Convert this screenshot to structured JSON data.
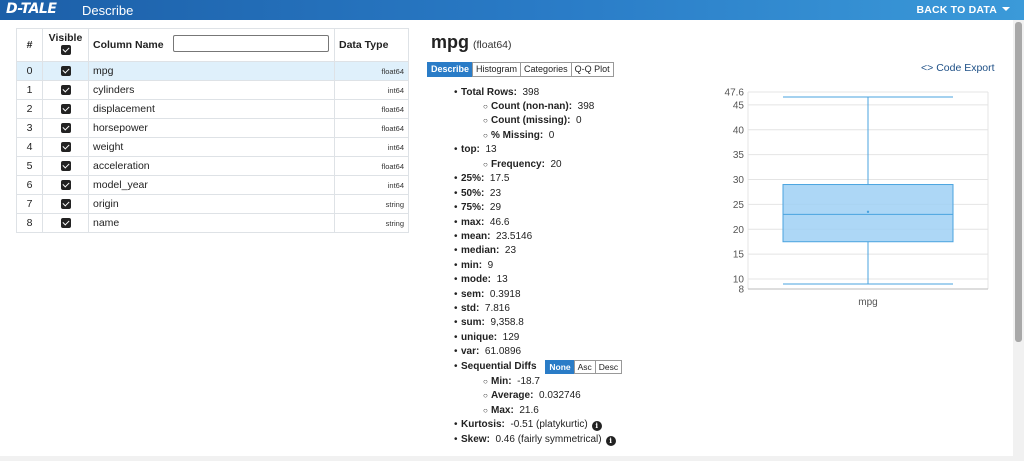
{
  "header": {
    "logo": "D-TALE",
    "title": "Describe",
    "back_label": "BACK TO DATA"
  },
  "table": {
    "headers": {
      "index": "#",
      "visible": "Visible",
      "name": "Column Name",
      "dtype": "Data Type"
    },
    "rows": [
      {
        "index": "0",
        "name": "mpg",
        "dtype": "float64"
      },
      {
        "index": "1",
        "name": "cylinders",
        "dtype": "int64"
      },
      {
        "index": "2",
        "name": "displacement",
        "dtype": "float64"
      },
      {
        "index": "3",
        "name": "horsepower",
        "dtype": "float64"
      },
      {
        "index": "4",
        "name": "weight",
        "dtype": "int64"
      },
      {
        "index": "5",
        "name": "acceleration",
        "dtype": "float64"
      },
      {
        "index": "6",
        "name": "model_year",
        "dtype": "int64"
      },
      {
        "index": "7",
        "name": "origin",
        "dtype": "string"
      },
      {
        "index": "8",
        "name": "name",
        "dtype": "string"
      }
    ]
  },
  "detail": {
    "column": "mpg",
    "dtype": "(float64)",
    "tabs": [
      "Describe",
      "Histogram",
      "Categories",
      "Q-Q Plot"
    ],
    "code_export": "Code Export",
    "stats": {
      "total_rows_label": "Total Rows:",
      "total_rows": "398",
      "count_label": "Count (non-nan):",
      "count": "398",
      "missing_label": "Count (missing):",
      "missing": "0",
      "pct_missing_label": "% Missing:",
      "pct_missing": "0",
      "top_label": "top:",
      "top": "13",
      "freq_label": "Frequency:",
      "freq": "20",
      "p25_label": "25%:",
      "p25": "17.5",
      "p50_label": "50%:",
      "p50": "23",
      "p75_label": "75%:",
      "p75": "29",
      "max_label": "max:",
      "max": "46.6",
      "mean_label": "mean:",
      "mean": "23.5146",
      "median_label": "median:",
      "median": "23",
      "min_label": "min:",
      "min": "9",
      "mode_label": "mode:",
      "mode": "13",
      "sem_label": "sem:",
      "sem": "0.3918",
      "std_label": "std:",
      "std": "7.816",
      "sum_label": "sum:",
      "sum": "9,358.8",
      "unique_label": "unique:",
      "unique": "129",
      "var_label": "var:",
      "var": "61.0896",
      "seq_label": "Sequential Diffs",
      "seq_buttons": [
        "None",
        "Asc",
        "Desc"
      ],
      "seq_min_label": "Min:",
      "seq_min": "-18.7",
      "seq_avg_label": "Average:",
      "seq_avg": "0.032746",
      "seq_max_label": "Max:",
      "seq_max": "21.6",
      "kurtosis_label": "Kurtosis:",
      "kurtosis": "-0.51 (platykurtic)",
      "skew_label": "Skew:",
      "skew": "0.46 (fairly symmetrical)"
    }
  },
  "chart_data": {
    "type": "box",
    "categories": [
      "mpg"
    ],
    "box": {
      "min": 9,
      "q1": 17.5,
      "median": 23,
      "q3": 29,
      "max": 46.6,
      "mean": 23.5146
    },
    "yticks": [
      8,
      10,
      15,
      20,
      25,
      30,
      35,
      40,
      45,
      47.6
    ],
    "ylim": [
      8,
      47.6
    ],
    "grid": true,
    "colors": {
      "fill": "#9fd0f5",
      "stroke": "#4aa3df"
    }
  }
}
